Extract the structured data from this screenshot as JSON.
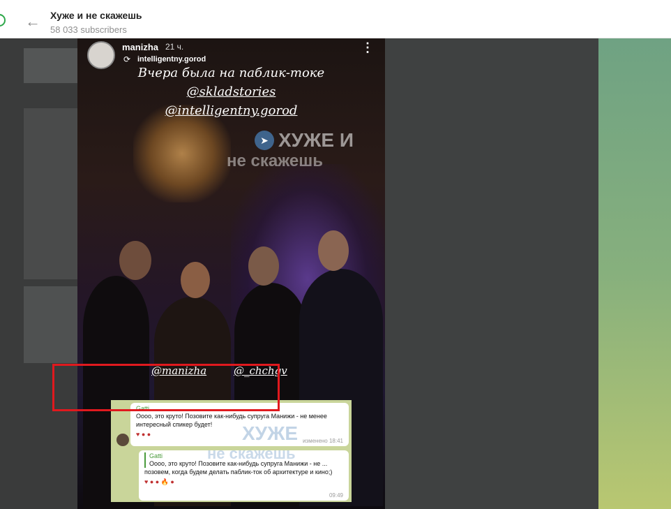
{
  "header": {
    "title": "Хуже и не скажешь",
    "subscribers": "58 033 subscribers",
    "back_glyph": "←"
  },
  "story": {
    "author": "manizha",
    "time": "21 ч.",
    "repost_from": "intelligentny.gorod",
    "caption_line1": "Вчера была на паблик-токе",
    "caption_tag1": "@skladstories",
    "caption_tag2": "@intelligentny.gorod",
    "tag_people1": "@manizha",
    "tag_people2": "@_chchgv",
    "watermark_line1": "ХУЖЕ И",
    "watermark_line2": "не скажешь",
    "menu_glyph": "⋮",
    "repost_glyph": "⟳"
  },
  "screenshot": {
    "msg1": {
      "author": "Gatti",
      "text": "Оооо, это круто! Позовите как-нибудь супруга Манижи - не менее интересный спикер будет!",
      "reactions": "♥ ● ●",
      "time": "изменено 18:41"
    },
    "msg2": {
      "quote_author": "Gatti",
      "quote_text": "Оооо, это круто! Позовите как-нибудь супруга Манижи - не ...",
      "text": "позовем, когда будем делать паблик-ток об архитектуре и кино;)",
      "reactions": "♥ ● ● 🔥 ●",
      "time": "09:49"
    },
    "watermark_line1": "ХУЖЕ",
    "watermark_line2": "не скажешь"
  },
  "colors": {
    "highlight": "#e0191e",
    "author_green": "#4a9b3c"
  }
}
